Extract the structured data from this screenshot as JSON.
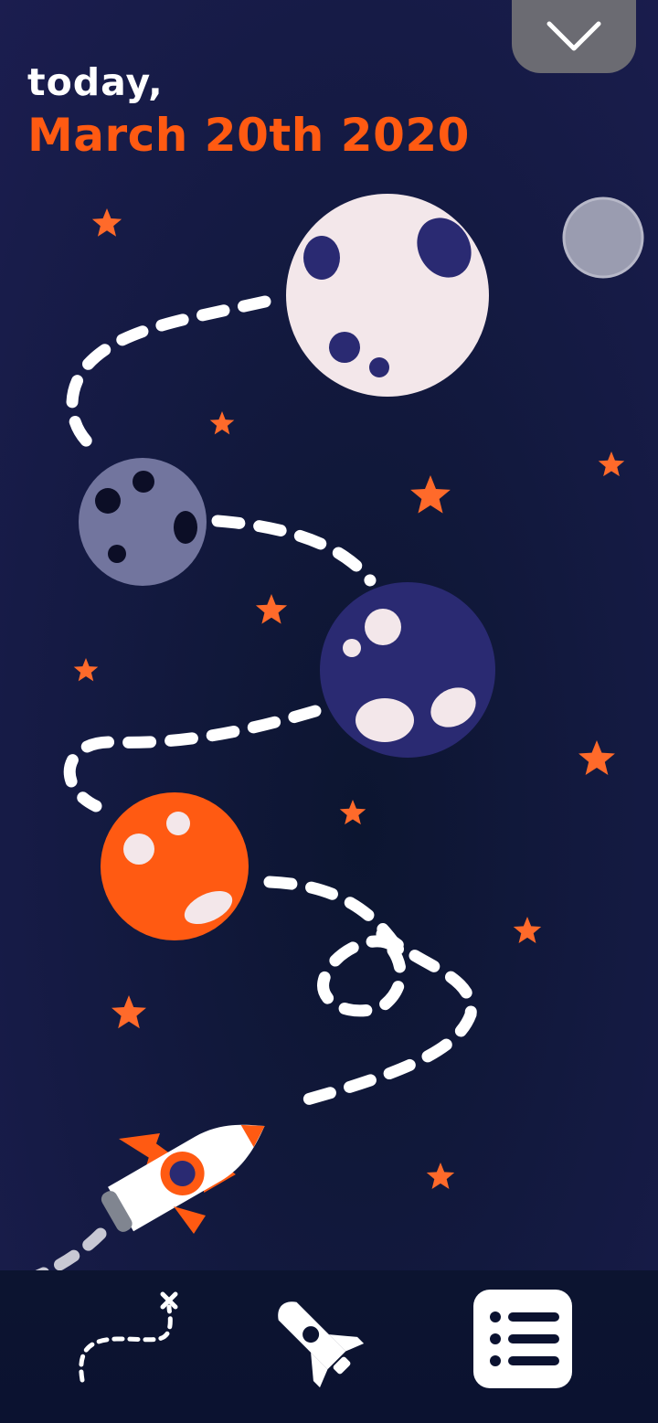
{
  "header": {
    "today_label": "today,",
    "date_label": "March 20th 2020"
  },
  "icons": {
    "collapse": "chevron-down-icon",
    "route_nav": "dotted-route-icon",
    "rocket_nav": "rocket-icon",
    "list_nav": "list-icon"
  },
  "colors": {
    "background": "#141a42",
    "accent": "#ff5a12",
    "star": "#ff6a2a",
    "planet_light": "#f3e7ea",
    "planet_grey": "#72759e",
    "planet_navy": "#2a2a72",
    "tab_grey": "#6b6b72"
  }
}
